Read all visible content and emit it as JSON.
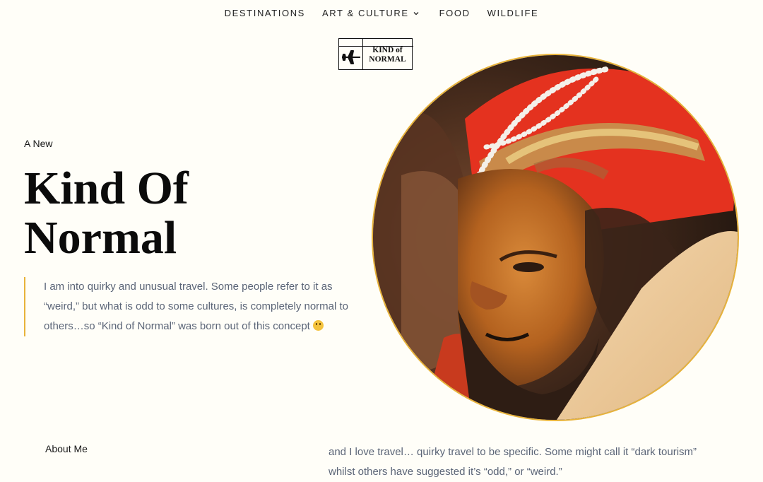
{
  "nav": {
    "items": [
      {
        "label": "DESTINATIONS"
      },
      {
        "label": "ART & CULTURE"
      },
      {
        "label": "FOOD"
      },
      {
        "label": "WILDLIFE"
      }
    ]
  },
  "logo": {
    "line1": "KIND of",
    "line2": "NORMAL"
  },
  "hero": {
    "eyebrow": "A New",
    "title_line1": "Kind Of",
    "title_line2": "Normal",
    "quote": "I am into quirky and unusual travel. Some people refer to it as “weird,” but what is odd to some cultures, is completely normal to others…so “Kind of Normal” was born out of this concept"
  },
  "about": {
    "label": "About Me",
    "text": "and I love travel… quirky travel to be specific. Some might call it “dark tourism” whilst others have suggested it’s “odd,” or “weird.”"
  },
  "colors": {
    "background": "#fffef8",
    "accent": "#e8b33a",
    "body_text": "#5b6577"
  }
}
